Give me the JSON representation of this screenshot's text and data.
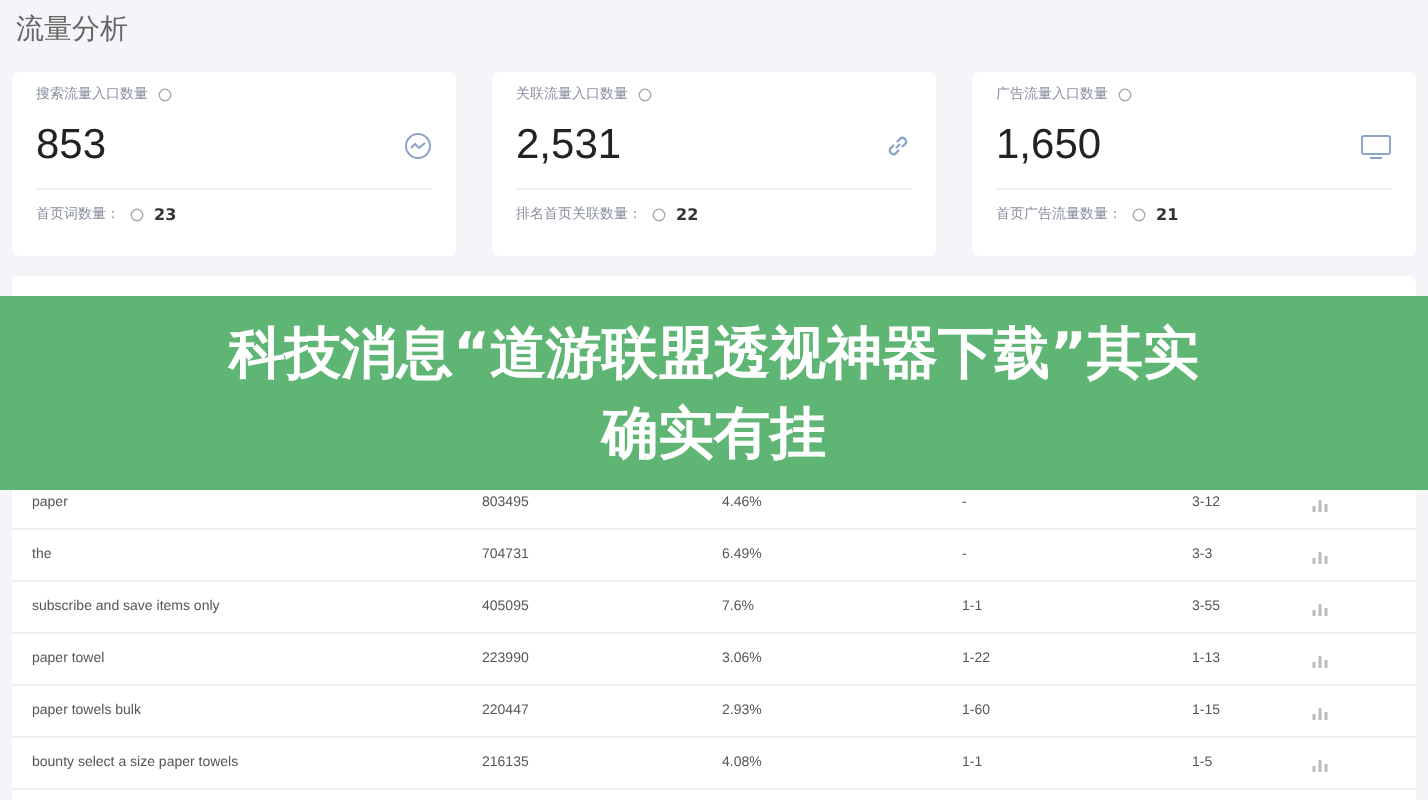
{
  "page_title": "流量分析",
  "stats": [
    {
      "label": "搜索流量入口数量",
      "value": "853",
      "footer_label": "首页词数量：",
      "footer_value": "23"
    },
    {
      "label": "关联流量入口数量",
      "value": "2,531",
      "footer_label": "排名首页关联数量：",
      "footer_value": "22"
    },
    {
      "label": "广告流量入口数量",
      "value": "1,650",
      "footer_label": "首页广告流量数量：",
      "footer_value": "21"
    }
  ],
  "rows": [
    {
      "keyword": "paper",
      "searches": "803495",
      "share": "4.46%",
      "ad_rank": "-",
      "natural_rank": "3-12"
    },
    {
      "keyword": "the",
      "searches": "704731",
      "share": "6.49%",
      "ad_rank": "-",
      "natural_rank": "3-3"
    },
    {
      "keyword": "subscribe and save items only",
      "searches": "405095",
      "share": "7.6%",
      "ad_rank": "1-1",
      "natural_rank": "3-55"
    },
    {
      "keyword": "paper towel",
      "searches": "223990",
      "share": "3.06%",
      "ad_rank": "1-22",
      "natural_rank": "1-13"
    },
    {
      "keyword": "paper towels bulk",
      "searches": "220447",
      "share": "2.93%",
      "ad_rank": "1-60",
      "natural_rank": "1-15"
    },
    {
      "keyword": "bounty select a size paper towels",
      "searches": "216135",
      "share": "4.08%",
      "ad_rank": "1-1",
      "natural_rank": "1-5"
    }
  ],
  "banner": {
    "lines": [
      "科技消息“道游联盟透视神器下载”其实",
      "确实有挂"
    ]
  }
}
